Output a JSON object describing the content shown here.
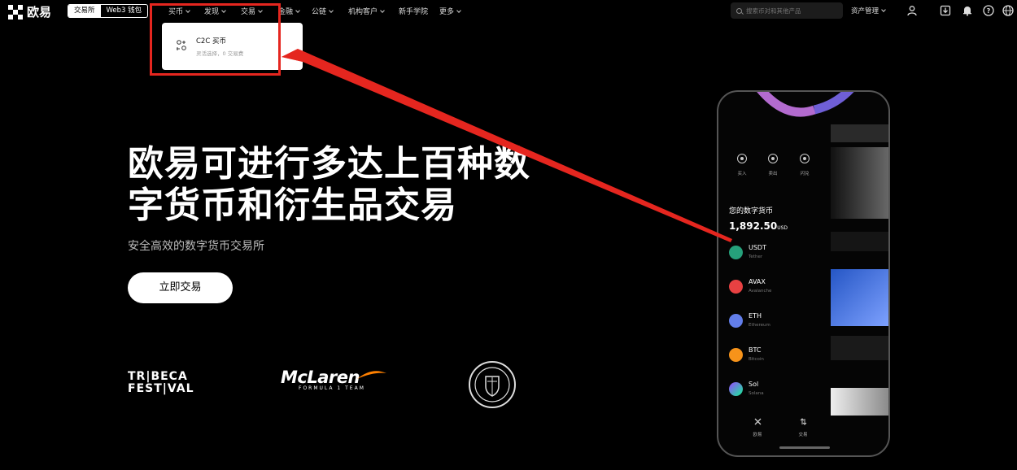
{
  "nav": {
    "logo_text": "欧易",
    "segment": [
      "交易所",
      "Web3 钱包"
    ],
    "items": [
      "买币",
      "发现",
      "交易",
      "金融",
      "公链",
      "机构客户",
      "新手学院",
      "更多"
    ],
    "search_placeholder": "搜索币对和其他产品",
    "asset_label": "资产管理"
  },
  "dropdown": {
    "title": "C2C 买币",
    "subtitle": "灵活选择，0 交易费"
  },
  "hero": {
    "title_line1": "欧易可进行多达上百种数",
    "title_line2": "字货币和衍生品交易",
    "subtitle": "安全高效的数字货币交易所",
    "cta": "立即交易"
  },
  "partners": {
    "tribeca_line1": "TR|BECA",
    "tribeca_line2": "FEST|VAL",
    "mclaren_name": "McLaren",
    "mclaren_sub": "FORMULA 1 TEAM"
  },
  "phone": {
    "actions": [
      "买入",
      "卖出",
      "闪兑"
    ],
    "assets_title": "您的数字货币",
    "assets_value": "1,892.50",
    "assets_unit": "USD",
    "coins": [
      {
        "symbol": "USDT",
        "name": "Tether",
        "color": "#26a17b"
      },
      {
        "symbol": "AVAX",
        "name": "Avalanche",
        "color": "#e84142"
      },
      {
        "symbol": "ETH",
        "name": "Ethereum",
        "color": "#627eea"
      },
      {
        "symbol": "BTC",
        "name": "Bitcoin",
        "color": "#f7931a"
      },
      {
        "symbol": "Sol",
        "name": "Solana",
        "color": "#9945ff"
      }
    ],
    "tabs": [
      "欧易",
      "交易"
    ]
  },
  "colors": {
    "annotation_red": "#e5261f",
    "background": "#000000"
  }
}
